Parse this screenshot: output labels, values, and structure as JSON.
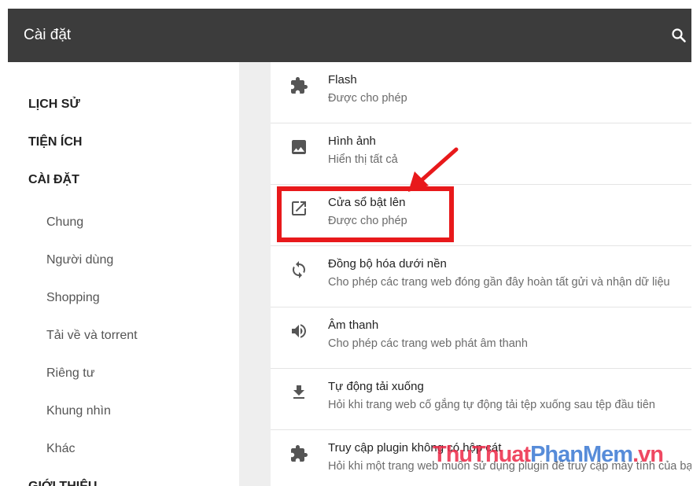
{
  "header": {
    "title": "Cài đặt",
    "search_icon": "search-icon"
  },
  "sidebar": {
    "sections": [
      {
        "label": "LỊCH SỬ"
      },
      {
        "label": "TIỆN ÍCH"
      },
      {
        "label": "CÀI ĐẶT"
      },
      {
        "label": "GIỚI THIỆU"
      }
    ],
    "subitems": [
      {
        "label": "Chung"
      },
      {
        "label": "Người dùng"
      },
      {
        "label": "Shopping"
      },
      {
        "label": "Tải về và torrent"
      },
      {
        "label": "Riêng tư"
      },
      {
        "label": "Khung nhìn"
      },
      {
        "label": "Khác"
      }
    ]
  },
  "permissions": [
    {
      "icon": "puzzle-piece-icon",
      "title": "Flash",
      "subtitle": "Được cho phép"
    },
    {
      "icon": "image-icon",
      "title": "Hình ảnh",
      "subtitle": "Hiển thị tất cả"
    },
    {
      "icon": "open-in-new-icon",
      "title": "Cửa sổ bật lên",
      "subtitle": "Được cho phép"
    },
    {
      "icon": "sync-icon",
      "title": "Đồng bộ hóa dưới nền",
      "subtitle": "Cho phép các trang web đóng gần đây hoàn tất gửi và nhận dữ liệu"
    },
    {
      "icon": "volume-icon",
      "title": "Âm thanh",
      "subtitle": "Cho phép các trang web phát âm thanh"
    },
    {
      "icon": "download-icon",
      "title": "Tự động tải xuống",
      "subtitle": "Hỏi khi trang web cố gắng tự động tải tệp xuống sau tệp đầu tiên"
    },
    {
      "icon": "puzzle-piece-icon",
      "title": "Truy cập plugin không có hộp cát",
      "subtitle": "Hỏi khi một trang web muốn sử dụng plugin để truy cập máy tính của bạn"
    }
  ],
  "annotation": {
    "highlight_color": "#e8191b"
  },
  "watermark": {
    "part1": "ThuThuat",
    "part2": "PhanMem",
    "part3": ".vn"
  },
  "colors": {
    "header_bg": "#3c3c3c",
    "sidebar_bg": "#ffffff",
    "content_bg": "#eeeeee",
    "icon_color": "#555555"
  }
}
